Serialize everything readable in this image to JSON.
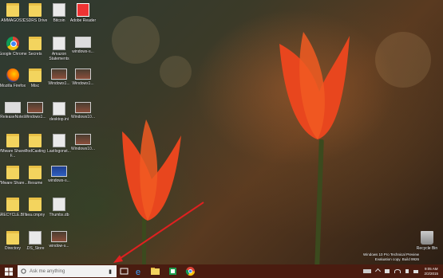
{
  "desktop": {
    "icons": [
      {
        "label": "AMMAGOSS",
        "kind": "folder"
      },
      {
        "label": "CSDRS Drive",
        "kind": "folder"
      },
      {
        "label": "Bitcoin",
        "kind": "doc"
      },
      {
        "label": "Adobe Reader",
        "kind": "pdf"
      },
      {
        "label": "Google Chrome",
        "kind": "chrome"
      },
      {
        "label": "Secrets",
        "kind": "folder"
      },
      {
        "label": "Amazon Statements",
        "kind": "doc"
      },
      {
        "label": "windows-s...",
        "kind": "thumb-white"
      },
      {
        "label": "Mozilla Firefox",
        "kind": "firefox"
      },
      {
        "label": "Misc",
        "kind": "folder"
      },
      {
        "label": "Windows1...",
        "kind": "thumb"
      },
      {
        "label": "Windows1...",
        "kind": "thumb"
      },
      {
        "label": "ReleaseNotes",
        "kind": "thumb-white"
      },
      {
        "label": "Windows1...",
        "kind": "thumb"
      },
      {
        "label": "desktop.ini",
        "kind": "doc"
      },
      {
        "label": "Windows10...",
        "kind": "thumb"
      },
      {
        "label": "VMware Shared F...",
        "kind": "folder"
      },
      {
        "label": "PodCasting",
        "kind": "folder"
      },
      {
        "label": "Lastlogonst...",
        "kind": "doc"
      },
      {
        "label": "Windows10...",
        "kind": "thumb"
      },
      {
        "label": "VMware Share...",
        "kind": "folder"
      },
      {
        "label": "Resume",
        "kind": "folder"
      },
      {
        "label": "windows-s...",
        "kind": "thumb-blue"
      },
      {
        "label": "$RECYCLE.BIN",
        "kind": "folder"
      },
      {
        "label": "sea.cmpny",
        "kind": "folder"
      },
      {
        "label": "Thumbs.db",
        "kind": "doc"
      },
      {
        "label": "Directory",
        "kind": "folder"
      },
      {
        "label": ".DS_Store",
        "kind": "doc"
      },
      {
        "label": "window-s...",
        "kind": "thumb"
      }
    ],
    "recycle_bin": {
      "label": "Recycle Bin"
    },
    "watermark": {
      "line1": "Windows 10 Pro Technical Preview",
      "line2": "Evaluation copy. Build 9926"
    }
  },
  "taskbar": {
    "search_placeholder": "Ask me anything",
    "apps": [
      "task-view-icon",
      "internet-explorer-icon",
      "file-explorer-icon",
      "store-icon",
      "chrome-icon"
    ],
    "clock_time": "9:05 AM",
    "clock_date": "2/2/2015"
  },
  "colors": {
    "taskbar": "#4a1c10",
    "folder": "#f3d45e",
    "tulip": "#e8461e"
  }
}
